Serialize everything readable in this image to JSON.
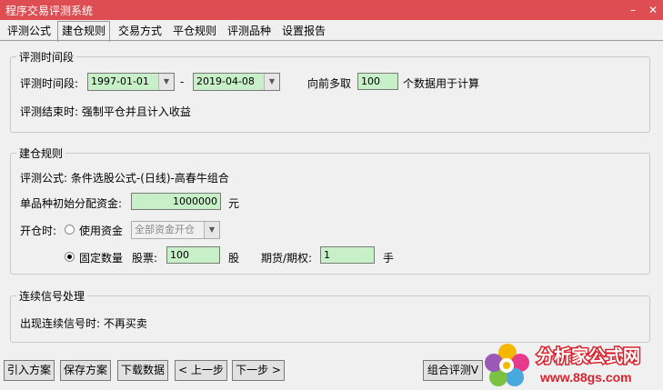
{
  "window": {
    "title": "程序交易评测系统"
  },
  "tabs": [
    "评测公式",
    "建仓规则",
    "交易方式",
    "平仓规则",
    "评测品种",
    "设置报告"
  ],
  "period": {
    "legend": "评测时间段",
    "label": "评测时间段:",
    "start": "1997-01-01",
    "dash": "-",
    "end": "2019-04-08",
    "pre_label": "向前多取",
    "pre_value": "100",
    "pre_suffix": "个数据用于计算",
    "end_rule": "评测结束时: 强制平仓并且计入收益"
  },
  "build": {
    "legend": "建仓规则",
    "formula": "评测公式:  条件选股公式-(日线)-高春牛组合",
    "capital_label": "单品种初始分配资金:",
    "capital_value": "1000000",
    "capital_unit": "元",
    "open_label": "开仓时:",
    "use_funds_label": "使用资金",
    "use_funds_option": "全部资金开仓",
    "fixed_qty_label": "固定数量",
    "stock_label": "股票:",
    "stock_value": "100",
    "stock_unit": "股",
    "futures_label": "期货/期权:",
    "futures_value": "1",
    "futures_unit": "手"
  },
  "signal": {
    "legend": "连续信号处理",
    "text": "出现连续信号时: 不再买卖"
  },
  "buttons": {
    "import": "引入方案",
    "save": "保存方案",
    "download": "下载数据",
    "prev": "< 上一步",
    "next": "下一步 >",
    "combo": "组合评测V"
  },
  "logo": {
    "brand": "分析家公式网",
    "url": "www.88gs.com"
  }
}
